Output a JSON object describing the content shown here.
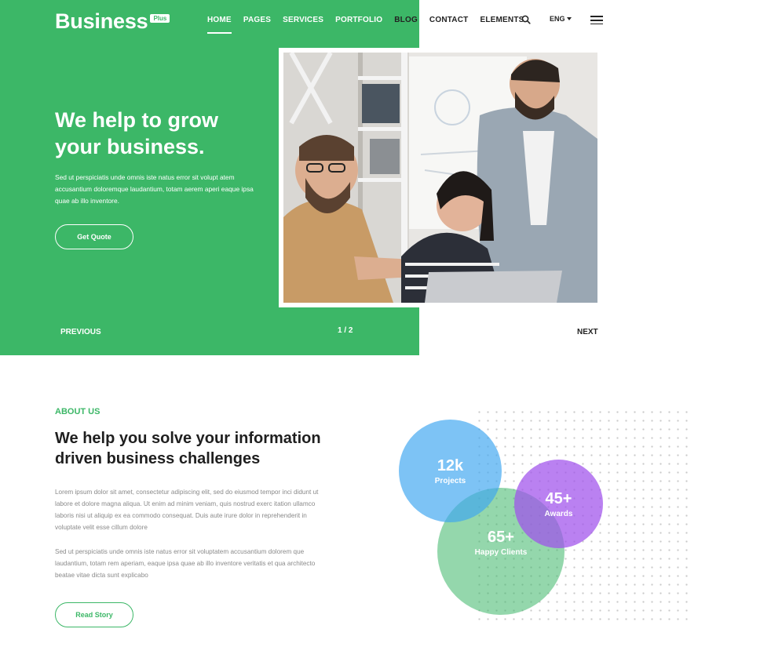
{
  "brand": {
    "name": "Business",
    "badge": "Plus"
  },
  "colors": {
    "accent": "#3cb767",
    "blue": "#3fa7f0",
    "purple": "#a050eb",
    "text_dark": "#222222"
  },
  "nav": {
    "items": [
      {
        "label": "HOME",
        "active": true
      },
      {
        "label": "PAGES"
      },
      {
        "label": "SERVICES"
      },
      {
        "label": "PORTFOLIO"
      },
      {
        "label": "BLOG"
      },
      {
        "label": "CONTACT"
      },
      {
        "label": "ELEMENTS"
      }
    ],
    "search_icon": "search-icon",
    "language": "ENG",
    "menu_icon": "hamburger-menu-icon"
  },
  "hero": {
    "title": "We help to grow your business.",
    "text": "Sed ut perspiciatis unde omnis iste natus error sit volupt atem accusantium doloremque laudantium, totam aerem aperi eaque ipsa quae ab illo inventore.",
    "cta": "Get Quote",
    "prev": "PREVIOUS",
    "next": "NEXT",
    "pager": "1 / 2"
  },
  "about": {
    "eyebrow": "ABOUT US",
    "title": "We help you solve your information driven business challenges",
    "paragraph1": "Lorem ipsum dolor sit amet, consectetur adipiscing elit, sed do eiusmod tempor inci didunt ut labore et dolore magna aliqua. Ut enim ad minim veniam, quis nostrud exerc itation ullamco laboris nisi ut aliquip ex ea commodo consequat. Duis aute irure dolor in reprehenderit in voluptate velit esse cillum dolore",
    "paragraph2": "Sed ut perspiciatis unde omnis iste natus error sit voluptatem accusantium dolorem que laudantium, totam rem aperiam, eaque ipsa quae ab illo inventore veritatis et qua architecto beatae vitae dicta sunt explicabo",
    "cta": "Read Story"
  },
  "stats": [
    {
      "value": "12k",
      "label": "Projects"
    },
    {
      "value": "45+",
      "label": "Awards"
    },
    {
      "value": "65+",
      "label": "Happy Clients"
    }
  ]
}
